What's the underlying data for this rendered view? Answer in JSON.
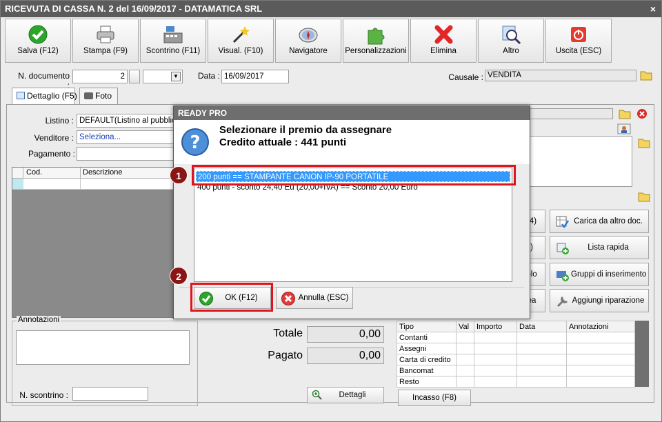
{
  "window": {
    "title": "RICEVUTA DI CASSA N. 2 del 16/09/2017 - DATAMATICA SRL",
    "close": "×"
  },
  "toolbar": [
    {
      "label": "Salva (F12)",
      "icon": "check-icon"
    },
    {
      "label": "Stampa (F9)",
      "icon": "printer-icon"
    },
    {
      "label": "Scontrino (F11)",
      "icon": "cash-register-icon"
    },
    {
      "label": "Visual. (F10)",
      "icon": "magic-wand-icon"
    },
    {
      "label": "Navigatore",
      "icon": "compass-icon"
    },
    {
      "label": "Personalizzazioni",
      "icon": "puzzle-icon"
    },
    {
      "label": "Elimina",
      "icon": "delete-x-icon"
    },
    {
      "label": "Altro",
      "icon": "magnifier-icon"
    },
    {
      "label": "Uscita (ESC)",
      "icon": "power-icon"
    }
  ],
  "header": {
    "doc_label": "N. documento :",
    "doc_value": "2",
    "date_label": "Data :",
    "date_value": "16/09/2017",
    "causale_label": "Causale :",
    "causale_value": "VENDITA"
  },
  "tabs": [
    {
      "label": "Dettaglio (F5)"
    },
    {
      "label": "Foto"
    }
  ],
  "form": {
    "listino_label": "Listino :",
    "listino_value": "DEFAULT(Listino al pubblico)",
    "venditore_label": "Venditore :",
    "venditore_value": "Seleziona...",
    "pagamento_label": "Pagamento :"
  },
  "grid": {
    "col_cod": "Cod.",
    "col_desc": "Descrizione"
  },
  "side_buttons": {
    "partial1": "(4)",
    "partial2": ")",
    "partial3": "olo",
    "partial4": "ea",
    "carica": "Carica da altro doc.",
    "lista": "Lista rapida",
    "gruppi": "Gruppi di inserimento",
    "aggiungi": "Aggiungi riparazione"
  },
  "notes": {
    "title": "Annotazioni",
    "scontrino_label": "N. scontrino :"
  },
  "totals": {
    "totale_label": "Totale",
    "totale_value": "0,00",
    "pagato_label": "Pagato",
    "pagato_value": "0,00",
    "dettagli": "Dettagli"
  },
  "payments": {
    "headers": [
      "Tipo",
      "Val",
      "Importo",
      "Data",
      "Annotazioni"
    ],
    "rows": [
      "Contanti",
      "Assegni",
      "Carta di credito",
      "Bancomat",
      "Resto"
    ],
    "incasso": "Incasso (F8)"
  },
  "dialog": {
    "title": "READY PRO",
    "heading": "Selezionare il premio da assegnare",
    "credit": "Credito attuale : 441 punti",
    "items": [
      "200 punti  == STAMPANTE CANON IP-90 PORTATILE",
      "400 punti  - sconto 24,40 Eu (20,00+IVA) == Sconto 20,00 Euro"
    ],
    "selected_index": 0,
    "ok": "OK (F12)",
    "cancel": "Annulla (ESC)"
  },
  "annotations": {
    "badge1": "1",
    "badge2": "2"
  }
}
